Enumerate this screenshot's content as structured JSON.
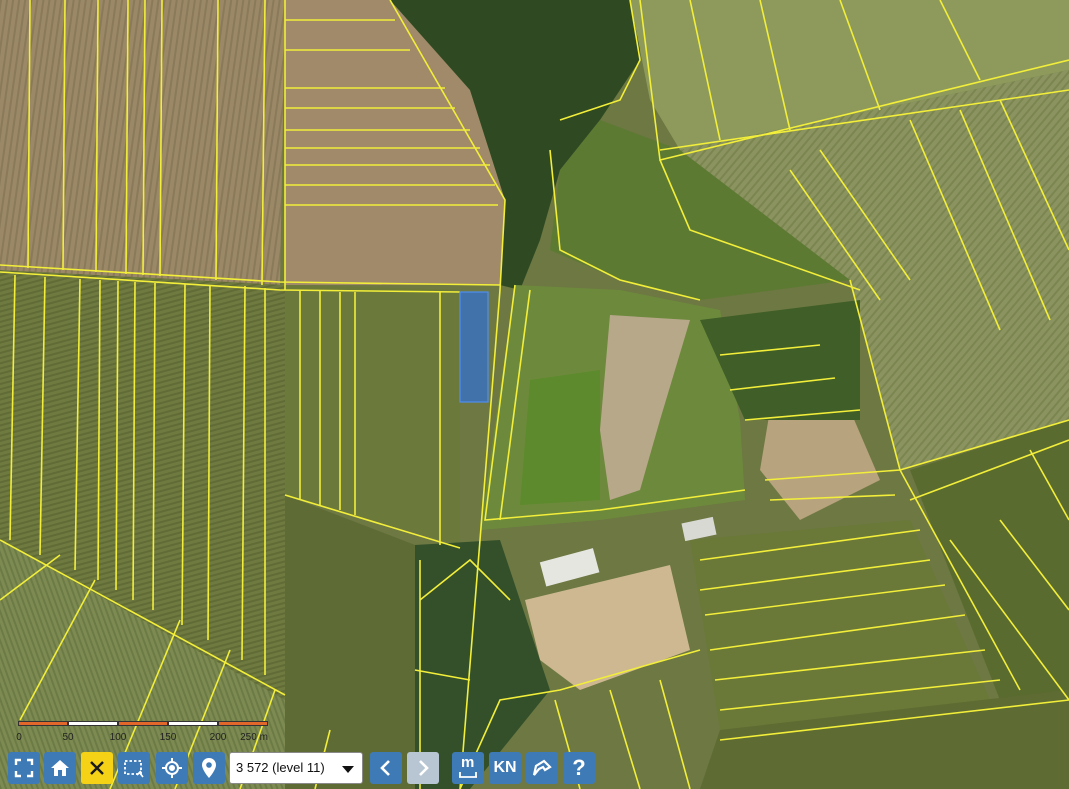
{
  "map": {
    "scale_labels": [
      "0",
      "50",
      "100",
      "150",
      "200",
      "250 m"
    ],
    "colors": {
      "parcel_border": "#f2ee3a",
      "selected_fill": "#2f6fd6",
      "scale_orange": "#e2672a",
      "scale_white": "#ffffff",
      "button_blue": "#3e7ab6",
      "button_active": "#f5d216",
      "button_disabled": "#b8c6d3"
    }
  },
  "toolbar": {
    "fullscreen_icon": "fullscreen-icon",
    "home_icon": "home-icon",
    "close_icon": "close-icon",
    "select_area_icon": "select-area-icon",
    "locate_icon": "locate-icon",
    "marker_icon": "marker-icon",
    "zoom_level": "3 572 (level 11)",
    "back_icon": "chevron-left-icon",
    "forward_icon": "chevron-right-icon",
    "m_label": "m",
    "kn_label": "KN",
    "share_icon": "share-icon",
    "help_label": "?"
  }
}
